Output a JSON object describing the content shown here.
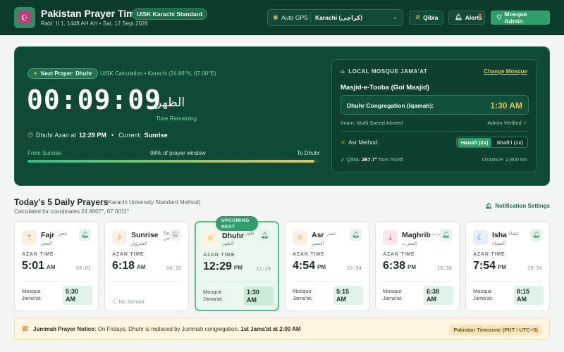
{
  "header": {
    "logo_glyph": "☪",
    "title": "Pakistan Prayer Times",
    "badge": "UISK Karachi Standard",
    "date": "Rabiʿ II 1, 1448 AH AH • Sat, 12 Sept 2026",
    "gps_label": "Auto GPS",
    "city": "Karachi (کراچی)",
    "qibla_label": "Qibla",
    "alerts_label": "Alerts",
    "admin_label": "Mosque Admin"
  },
  "hero": {
    "next_label": "Next Prayer: Dhuhr",
    "calc_info": "UISK Calculation • Karachi (24.86°N, 67.00°E)",
    "countdown": "00:09:09",
    "arabic_name": "الظهر",
    "time_remaining": "Time Remaining",
    "azan_prefix": "Dhuhr Azan at",
    "azan_time": "12:29 PM",
    "dot": "•",
    "current_prefix": "Current:",
    "current": "Sunrise",
    "from_label": "From Sunrise",
    "window_label": "98% of prayer window",
    "to_label": "To Dhuhr",
    "progress_fraction": 0.98
  },
  "mosque": {
    "title": "LOCAL MOSQUE JAMA'AT",
    "change_label": "Change Mosque",
    "name": "Masjid-e-Tooba (Gol Masjid)",
    "cong_label": "Dhuhr Congregation (Iqamah):",
    "cong_time": "1:30 AM",
    "imam": "Imam: Mufti Saeed Ahmed",
    "verified": "Admin Verified ✓",
    "asr_label": "Asr Method:",
    "asr_options": [
      "Hanafi (2x)",
      "Shafi'i (1x)"
    ],
    "asr_selected": "Hanafi (2x)",
    "qibla_prefix": "Qibla:",
    "qibla_value": "267.7°",
    "qibla_suffix": "from North",
    "distance": "Distance: 2,800 km"
  },
  "daily": {
    "title": "Today's 5 Daily Prayers",
    "method": "(Karachi University Standard Method)",
    "coords": "Calculated for coordinates 24.8607°, 67.0011°",
    "notif_label": "Notification Settings",
    "azan_label": "AZAN TIME",
    "jamaat_label": "Mosque Jama'at:",
    "upcoming_label": "UPCOMING NEXT",
    "prayers": [
      {
        "name": "Fajr",
        "ar1": "فجر",
        "ar2": "الفجر",
        "time": "5:01",
        "ampm": "AM",
        "t24": "05:01",
        "jamaat": "5:30 AM",
        "icon": "sunrise-icon"
      },
      {
        "name": "Sunrise",
        "ar1": "طلوع الشمس",
        "ar2": "الشروق",
        "time": "6:18",
        "ampm": "AM",
        "t24": "06:18",
        "jamaat": "No Jamaat",
        "icon": "sun-icon"
      },
      {
        "name": "Dhuhr",
        "ar1": "ظهر",
        "ar2": "الظهر",
        "time": "12:29",
        "ampm": "PM",
        "t24": "12:29",
        "jamaat": "1:30 AM",
        "icon": "sun-icon"
      },
      {
        "name": "Asr",
        "ar1": "عصر",
        "ar2": "العصر",
        "time": "4:54",
        "ampm": "PM",
        "t24": "16:54",
        "jamaat": "5:15 AM",
        "icon": "sun-icon"
      },
      {
        "name": "Maghrib",
        "ar1": "مغرب",
        "ar2": "المغرب",
        "time": "6:38",
        "ampm": "PM",
        "t24": "18:38",
        "jamaat": "6:38 AM",
        "icon": "sunset-icon"
      },
      {
        "name": "Isha",
        "ar1": "عشاء",
        "ar2": "العشاء",
        "time": "7:54",
        "ampm": "PM",
        "t24": "19:54",
        "jamaat": "8:15 AM",
        "icon": "moon-icon"
      }
    ]
  },
  "notice": {
    "lead": "Jummah Prayer Notice:",
    "text": "On Fridays, Dhuhr is replaced by Jummah congregation.",
    "tail": "1st Jama'at at 2:00 AM",
    "timezone": "Pakistan Timezone (PKT / UTC+5)"
  },
  "colors": {
    "header_bg": "#0d3b2c",
    "hero_bg": "#0f4a37",
    "accent_green": "#2f9e6b",
    "accent_gold": "#e7c04c"
  }
}
